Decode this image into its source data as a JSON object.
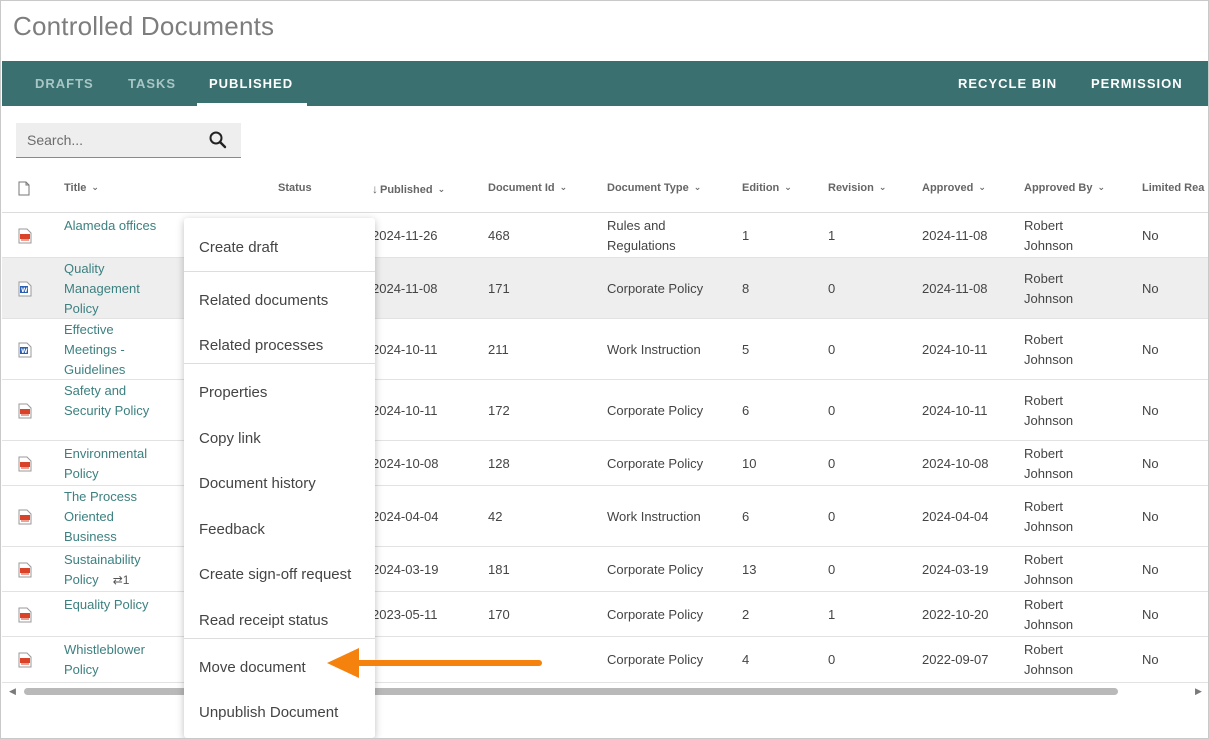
{
  "app": {
    "title": "Controlled Documents"
  },
  "nav": {
    "tabs": [
      {
        "label": "DRAFTS"
      },
      {
        "label": "TASKS"
      },
      {
        "label": "PUBLISHED"
      }
    ],
    "right": [
      {
        "label": "RECYCLE BIN"
      },
      {
        "label": "PERMISSION"
      }
    ],
    "active_color": "#3a7070"
  },
  "search": {
    "placeholder": "Search..."
  },
  "table": {
    "headers": {
      "title": "Title",
      "status": "Status",
      "published": "Published",
      "document_id": "Document Id",
      "document_type": "Document Type",
      "edition": "Edition",
      "revision": "Revision",
      "approved": "Approved",
      "approved_by": "Approved By",
      "limited_read": "Limited Rea"
    },
    "rows": [
      {
        "icon": "pdf-icon",
        "title": "Alameda offices",
        "published": "2024-11-26",
        "doc_id": "468",
        "doc_type": "Rules and Regulations",
        "edition": "1",
        "revision": "1",
        "approved": "2024-11-08",
        "approved_by": "Robert Johnson",
        "limited": "No"
      },
      {
        "icon": "word-icon",
        "title": "Quality Management Policy",
        "published": "2024-11-08",
        "doc_id": "171",
        "doc_type": "Corporate Policy",
        "edition": "8",
        "revision": "0",
        "approved": "2024-11-08",
        "approved_by": "Robert Johnson",
        "limited": "No"
      },
      {
        "icon": "word-icon",
        "title": "Effective Meetings - Guidelines",
        "published": "2024-10-11",
        "doc_id": "211",
        "doc_type": "Work Instruction",
        "edition": "5",
        "revision": "0",
        "approved": "2024-10-11",
        "approved_by": "Robert Johnson",
        "limited": "No"
      },
      {
        "icon": "pdf-icon",
        "title": "Safety and Security Policy",
        "published": "2024-10-11",
        "doc_id": "172",
        "doc_type": "Corporate Policy",
        "edition": "6",
        "revision": "0",
        "approved": "2024-10-11",
        "approved_by": "Robert Johnson",
        "limited": "No"
      },
      {
        "icon": "pdf-icon",
        "title": "Environmental Policy",
        "published": "2024-10-08",
        "doc_id": "128",
        "doc_type": "Corporate Policy",
        "edition": "10",
        "revision": "0",
        "approved": "2024-10-08",
        "approved_by": "Robert Johnson",
        "limited": "No"
      },
      {
        "icon": "pdf-icon",
        "title": "The Process Oriented Business",
        "published": "2024-04-04",
        "doc_id": "42",
        "doc_type": "Work Instruction",
        "edition": "6",
        "revision": "0",
        "approved": "2024-04-04",
        "approved_by": "Robert Johnson",
        "limited": "No"
      },
      {
        "icon": "pdf-icon",
        "title": "Sustainability Policy",
        "link_count": "1",
        "published": "2024-03-19",
        "doc_id": "181",
        "doc_type": "Corporate Policy",
        "edition": "13",
        "revision": "0",
        "approved": "2024-03-19",
        "approved_by": "Robert Johnson",
        "limited": "No"
      },
      {
        "icon": "pdf-icon",
        "title": "Equality Policy",
        "published": "2023-05-11",
        "doc_id": "170",
        "doc_type": "Corporate Policy",
        "edition": "2",
        "revision": "1",
        "approved": "2022-10-20",
        "approved_by": "Robert Johnson",
        "limited": "No"
      },
      {
        "icon": "pdf-icon",
        "title": "Whistleblower Policy",
        "published": "",
        "doc_id": "",
        "doc_type": "Corporate Policy",
        "edition": "4",
        "revision": "0",
        "approved": "2022-09-07",
        "approved_by": "Robert Johnson",
        "limited": "No"
      }
    ]
  },
  "context_menu": {
    "items": [
      "Create draft",
      "Related documents",
      "Related processes",
      "Properties",
      "Copy link",
      "Document history",
      "Feedback",
      "Create sign-off request",
      "Read receipt status",
      "Move document",
      "Unpublish Document"
    ]
  },
  "colors": {
    "accent": "#3a7070",
    "link": "#3d8080",
    "arrow": "#f5820d"
  }
}
